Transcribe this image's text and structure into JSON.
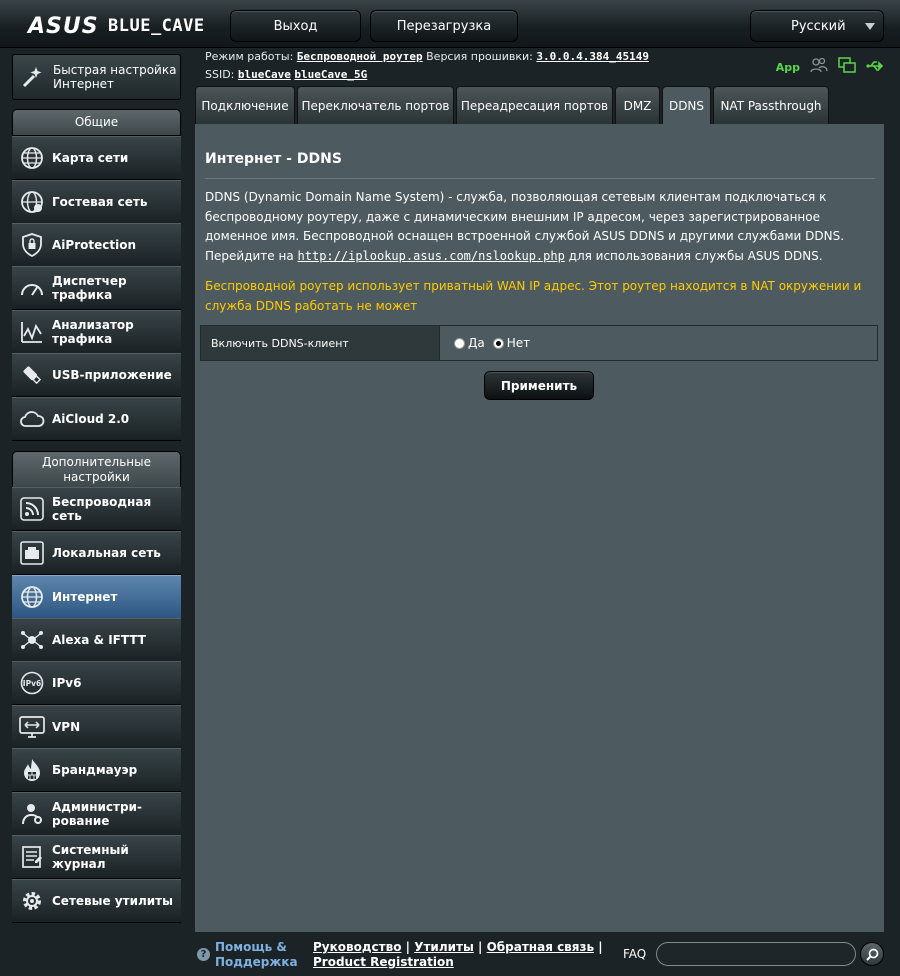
{
  "header": {
    "logo": "ASUS",
    "model": "BLUE_CAVE",
    "logout_label": "Выход",
    "reboot_label": "Перезагрузка",
    "language": "Русский"
  },
  "info": {
    "mode_label": "Режим работы:",
    "mode_value": "Беспроводной роутер",
    "fw_label": "Версия прошивки:",
    "fw_value": "3.0.0.4.384_45149",
    "ssid_label": "SSID:",
    "ssid_1": "blueCave",
    "ssid_2": "blueCave_5G",
    "app_label": "App"
  },
  "sidebar": {
    "quick_setup": "Быстрая настройка Интернет",
    "general_heading": "Общие",
    "advanced_heading": "Дополнительные настройки",
    "general": [
      {
        "label": "Карта сети"
      },
      {
        "label": "Гостевая сеть"
      },
      {
        "label": "AiProtection"
      },
      {
        "label": "Диспетчер трафика"
      },
      {
        "label": "Анализатор трафика"
      },
      {
        "label": "USB-приложение"
      },
      {
        "label": "AiCloud 2.0"
      }
    ],
    "advanced": [
      {
        "label": "Беспроводная сеть"
      },
      {
        "label": "Локальная сеть"
      },
      {
        "label": "Интернет"
      },
      {
        "label": "Alexa & IFTTT"
      },
      {
        "label": "IPv6"
      },
      {
        "label": "VPN"
      },
      {
        "label": "Брандмауэр"
      },
      {
        "label": "Администри-рование"
      },
      {
        "label": "Системный журнал"
      },
      {
        "label": "Сетевые утилиты"
      }
    ]
  },
  "tabs": [
    {
      "label": "Подключение"
    },
    {
      "label": "Переключатель портов"
    },
    {
      "label": "Переадресация портов"
    },
    {
      "label": "DMZ"
    },
    {
      "label": "DDNS"
    },
    {
      "label": "NAT Passthrough"
    }
  ],
  "main": {
    "title": "Интернет - DDNS",
    "desc": "DDNS (Dynamic Domain Name System) - служба, позволяющая сетевым клиентам подключаться к беспроводному роутеру, даже с динамическим внешним IP адресом, через зарегистрированное доменное имя. Беспроводной оснащен встроенной службой ASUS DDNS и другими службами DDNS.",
    "goto_prefix": "Перейдите на",
    "goto_link": "http://iplookup.asus.com/nslookup.php",
    "goto_suffix": "для использования службы ASUS DDNS.",
    "warning": "Беспроводной роутер использует приватный WAN IP адрес. Этот роутер находится в NAT окружении и служба DDNS работать не может",
    "enable_label": "Включить DDNS-клиент",
    "yes_label": "Да",
    "no_label": "Нет",
    "apply_label": "Применить"
  },
  "footer": {
    "help": "Помощь & Поддержка",
    "manual": "Руководство",
    "utilities": "Утилиты",
    "feedback": "Обратная связь",
    "product_registration": "Product Registration",
    "faq": "FAQ",
    "search_value": ""
  },
  "colors": {
    "panel": "#4d5a5f",
    "warning": "#ffcc00",
    "active_nav": "#4a74a0",
    "app_green": "#5bd649"
  }
}
